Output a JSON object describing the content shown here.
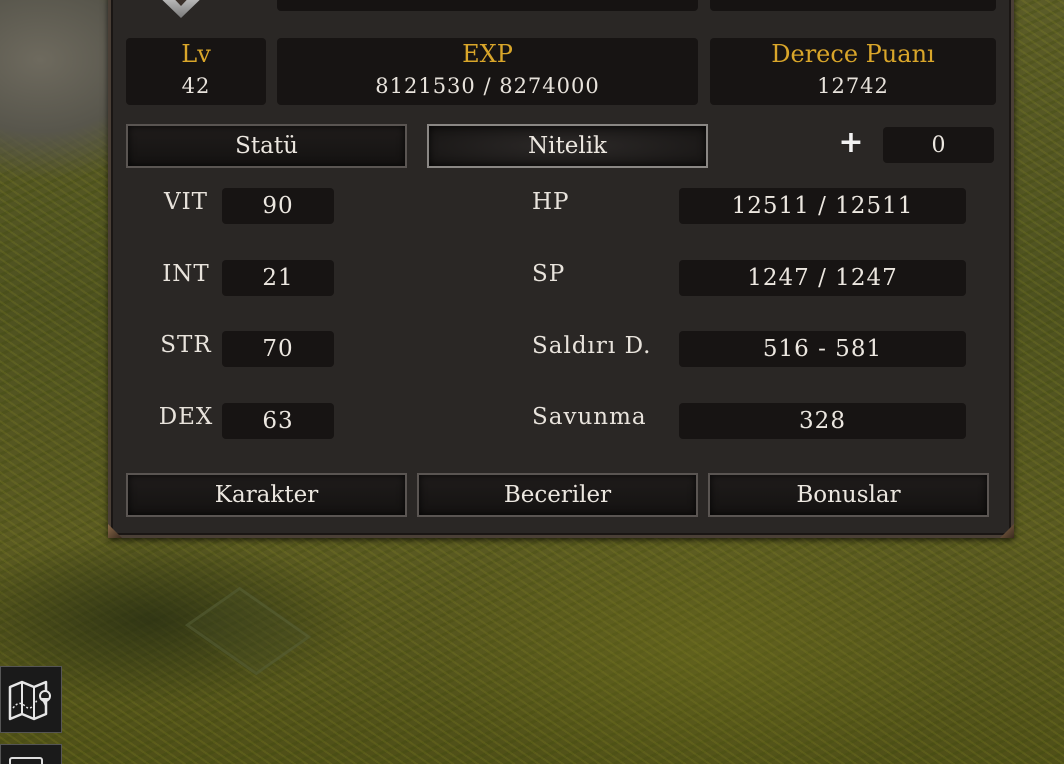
{
  "header": {
    "level": {
      "label": "Lv",
      "value": "42"
    },
    "exp": {
      "label": "EXP",
      "value": "8121530 / 8274000"
    },
    "rank": {
      "label": "Derece Puanı",
      "value": "12742"
    }
  },
  "tabs": {
    "status": "Statü",
    "attribute": "Nitelik"
  },
  "points": {
    "plus": "+",
    "value": "0"
  },
  "stats": [
    {
      "label": "VIT",
      "value": "90"
    },
    {
      "label": "INT",
      "value": "21"
    },
    {
      "label": "STR",
      "value": "70"
    },
    {
      "label": "DEX",
      "value": "63"
    }
  ],
  "derived": [
    {
      "label": "HP",
      "value": "12511 / 12511"
    },
    {
      "label": "SP",
      "value": "1247 / 1247"
    },
    {
      "label": "Saldırı D.",
      "value": "516 - 581"
    },
    {
      "label": "Savunma",
      "value": "328"
    }
  ],
  "bottom_buttons": {
    "character": "Karakter",
    "skills": "Beceriler",
    "bonuses": "Bonuslar"
  },
  "icons": {
    "map": "map-icon",
    "emblem": "guild-emblem-icon"
  },
  "colors": {
    "accent_gold": "#d9a62a",
    "panel_bg": "#2a2725",
    "field_bg": "#171413"
  }
}
